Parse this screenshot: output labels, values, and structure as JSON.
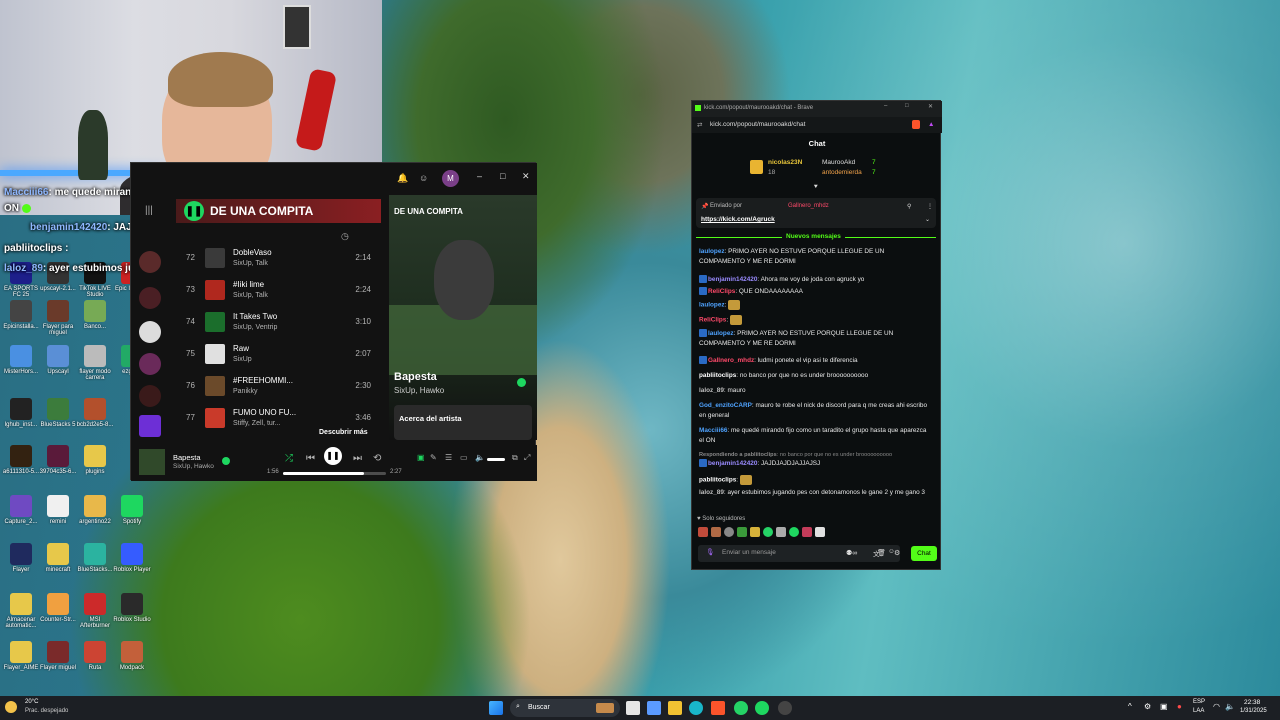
{
  "stream_overlay": {
    "msg1_user": "Macciii66",
    "msg1_text": ": me quede mirando fijo como un taradito el grupo hasta que aparezca el",
    "msg1_cont": "ON",
    "msg2_user": "benjamin142420",
    "msg2_text": ": JAJDJAJDJAJJAJSJ",
    "msg3_user": "pabliitoclips",
    "msg3_text": ":",
    "msg4_user": "laloz_89",
    "msg4_text": ": ayer estubimos jugando pes con detonamonos le gane 2 y me gano 3"
  },
  "desktop_icons": [
    "EA SPORTS FC 25",
    "upscayl-2.1...",
    "TikTok LIVE Studio",
    "Epic Install...",
    "Epicinstalla...",
    "Flayer para miguel",
    "Banco...",
    "MisterHors...",
    "Upscayl",
    "flayer modo carrera",
    "ezgif-...",
    "lghub_inst...",
    "BlueStacks 5",
    "bcb2d2e5-8...",
    "a6111310-5...",
    "39704c35-6...",
    "plugins",
    "Capture_2...",
    "remini",
    "argentino22",
    "Spotify",
    "Flayer",
    "minecraft",
    "BlueStacks...",
    "Roblox Player",
    "Almacenar automatic...",
    "Counter-Str...",
    "MSI Afterburner",
    "Roblox Studio",
    "Flayer_AIME",
    "Flayer miguel",
    "Ruta",
    "Modpack"
  ],
  "spotify": {
    "banner_title": "DE UNA COMPITA",
    "nowplaying_header": "DE UNA COMPITA",
    "tracks": [
      {
        "num": "72",
        "title": "DobleVaso",
        "artist": "SixUp, Talk",
        "dur": "2:14"
      },
      {
        "num": "73",
        "title": "#Iiki lime",
        "artist": "SixUp, Talk",
        "dur": "2:24"
      },
      {
        "num": "74",
        "title": "It Takes Two",
        "artist": "SixUp, Ventrip",
        "dur": "3:10"
      },
      {
        "num": "75",
        "title": "Raw",
        "artist": "SixUp",
        "dur": "2:07"
      },
      {
        "num": "76",
        "title": "#FREEHOMMI...",
        "artist": "Panikky",
        "dur": "2:30"
      },
      {
        "num": "77",
        "title": "FUMO UNO FU...",
        "artist": "Stiffy, Zell, tur...",
        "dur": "3:46"
      }
    ],
    "discover": "Descubrir más",
    "np_title": "Bapesta",
    "np_artist": "SixUp, Hawko",
    "about": "Acerca del artista",
    "player_title": "Bapesta",
    "player_artist": "SixUp, Hawko",
    "elapsed": "1:56",
    "total": "2:27",
    "progress": 0.79,
    "avatar": "M"
  },
  "kick": {
    "title_bar": "kick.com/popout/maurooakd/chat - Brave",
    "url": "kick.com/popout/maurooakd/chat",
    "chat_title": "Chat",
    "top1_name": "nicolas23N",
    "top1_count": "18",
    "top2_name": "MaurooAkd",
    "top2_count": "7",
    "top3_name": "antodemierda",
    "top3_count": "7",
    "pinned_by": "Enviado por",
    "pinned_user": "Gallnero_mhdz",
    "pinned_link": "https://kick.com/Agruck",
    "new_msgs": "Nuevos mensajes",
    "messages": [
      {
        "user": "laulopez",
        "text": "PRIMO AYER NO ESTUVE PORQUE LLEGUE DE UN COMPAMENTO Y ME RE DORMI",
        "color": "#4fa3ff"
      },
      {
        "user": "benjamin142420",
        "text": "Ahora me voy de joda con agruck yo",
        "color": "#9a8bff"
      },
      {
        "user": "ReliClips",
        "text": "QUE ONDAAAAAAAA",
        "color": "#ff4a6a"
      },
      {
        "user": "laulopez",
        "text": "",
        "color": "#4fa3ff"
      },
      {
        "user": "ReliClips",
        "text": "",
        "color": "#ff4a6a"
      },
      {
        "user": "laulopez",
        "text": "PRIMO AYER NO ESTUVE PORQUE LLEGUE DE UN COMPAMENTO Y ME RE DORMI",
        "color": "#4fa3ff"
      },
      {
        "user": "Gallnero_mhdz",
        "text": "ludmi ponete el vip asi te diferencia",
        "color": "#ff4a6a"
      },
      {
        "user": "pabliitoclips",
        "text": "no banco por que no es under broooooooooo",
        "color": "#ffffff"
      },
      {
        "user": "laloz_89",
        "text": "mauro",
        "color": "#bfbfbf"
      },
      {
        "user": "God_enzitoCARP",
        "text": "mauro te robe el nick de discord para q me creas ahi escribo en general",
        "color": "#4fa3ff"
      },
      {
        "user": "Macciii66",
        "text": "me quedé mirando fijo como un taradito el grupo hasta que aparezca el ON",
        "color": "#4fa3ff"
      },
      {
        "user": "Respondiendo a pabliitoclips",
        "text": "no banco por que no es under broooooooooo",
        "color": "#8a8a8a"
      },
      {
        "user": "benjamin142420",
        "text": "JAJDJAJDJAJJAJSJ",
        "color": "#9a8bff"
      },
      {
        "user": "pabliitoclips",
        "text": "",
        "color": "#ffffff"
      },
      {
        "user": "laloz_89",
        "text": "ayer estubimos jugando pes con detonamonos le gane 2 y me gano 3",
        "color": "#bfbfbf"
      }
    ],
    "followers_only": "Solo seguidores",
    "input_placeholder": "Enviar un mensaje",
    "chat_button": "Chat",
    "accent": "#53fc18"
  },
  "taskbar": {
    "weather_temp": "20°C",
    "weather_desc": "Prac. despejado",
    "search": "Buscar",
    "lang1": "ESP",
    "lang2": "LAA",
    "time": "22:38",
    "date": "1/31/2025"
  }
}
